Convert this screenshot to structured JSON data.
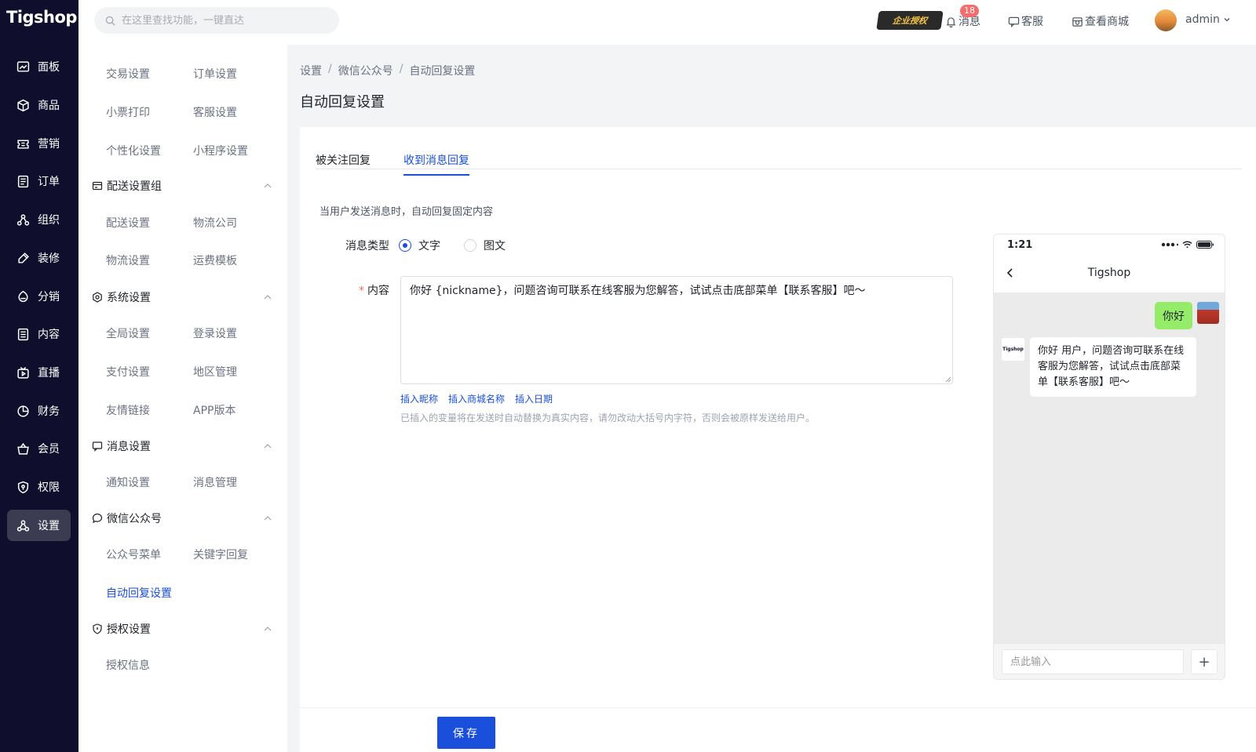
{
  "app": {
    "logo": "Tigshop"
  },
  "rail": {
    "items": [
      {
        "label": "面板",
        "icon": "dashboard-icon"
      },
      {
        "label": "商品",
        "icon": "box-icon"
      },
      {
        "label": "营销",
        "icon": "ticket-icon"
      },
      {
        "label": "订单",
        "icon": "order-icon"
      },
      {
        "label": "组织",
        "icon": "org-icon"
      },
      {
        "label": "装修",
        "icon": "brush-icon"
      },
      {
        "label": "分销",
        "icon": "share-icon"
      },
      {
        "label": "内容",
        "icon": "document-icon"
      },
      {
        "label": "直播",
        "icon": "live-icon"
      },
      {
        "label": "财务",
        "icon": "pie-icon"
      },
      {
        "label": "会员",
        "icon": "basket-icon"
      },
      {
        "label": "权限",
        "icon": "shield-icon"
      },
      {
        "label": "设置",
        "icon": "settings-icon",
        "active": true
      }
    ]
  },
  "header": {
    "search_placeholder": "在这里查找功能，一键直达",
    "auth_badge": "企业授权",
    "notif_count": "18",
    "messages": "消息",
    "service": "客服",
    "view_store": "查看商城",
    "user": "admin"
  },
  "submenu": {
    "top": [
      "交易设置",
      "订单设置",
      "小票打印",
      "客服设置",
      "个性化设置",
      "小程序设置"
    ],
    "groups": {
      "delivery": {
        "title": "配送设置组",
        "items": [
          "配送设置",
          "物流公司",
          "物流设置",
          "运费模板"
        ]
      },
      "system": {
        "title": "系统设置",
        "items": [
          "全局设置",
          "登录设置",
          "支付设置",
          "地区管理",
          "友情链接",
          "APP版本"
        ]
      },
      "message": {
        "title": "消息设置",
        "items": [
          "通知设置",
          "消息管理"
        ]
      },
      "wechat": {
        "title": "微信公众号",
        "items": [
          "公众号菜单",
          "关键字回复",
          "自动回复设置"
        ]
      },
      "license": {
        "title": "授权设置",
        "items": [
          "授权信息"
        ]
      }
    }
  },
  "breadcrumb": [
    "设置",
    "微信公众号",
    "自动回复设置"
  ],
  "page_title": "自动回复设置",
  "tabs": [
    {
      "label": "被关注回复",
      "active": false
    },
    {
      "label": "收到消息回复",
      "active": true
    }
  ],
  "form": {
    "description": "当用户发送消息时，自动回复固定内容",
    "type_label": "消息类型",
    "type_options": [
      {
        "label": "文字",
        "checked": true
      },
      {
        "label": "图文",
        "checked": false
      }
    ],
    "content_label": "内容",
    "content_required_mark": "*",
    "content_value": "你好 {nickname}，问题咨询可联系在线客服为您解答，试试点击底部菜单【联系客服】吧～",
    "insert_links": [
      "插入昵称",
      "插入商城名称",
      "插入日期"
    ],
    "hint": "已插入的变量将在发送时自动替换为真实内容，请勿改动大括号内字符，否则会被原样发送给用户。"
  },
  "phone": {
    "time": "1:21",
    "title": "Tigshop",
    "user_message": "你好",
    "bot_avatar_text": "Tigshop",
    "bot_message": "你好 用户，问题咨询可联系在线客服为您解答，试试点击底部菜单【联系客服】吧～",
    "input_placeholder": "点此输入",
    "plus": "+"
  },
  "footer": {
    "save_label": "保存"
  },
  "colors": {
    "primary": "#1a4fdc",
    "rail_bg": "#0f0f2d",
    "bubble_me": "#95ec69",
    "badge": "#f56c6c"
  }
}
